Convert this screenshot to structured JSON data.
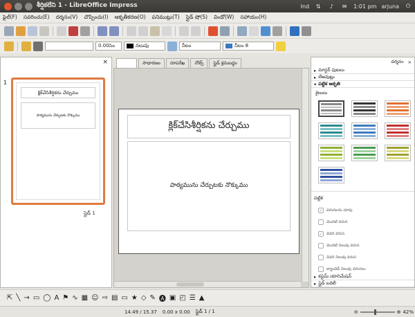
{
  "window": {
    "title": "శీర్షికలేని 1 - LibreOffice Impress",
    "tray": [
      "Ind",
      "1:01 pm",
      "arjuna"
    ]
  },
  "menu": [
    "ఫైల్(F)",
    "సవరించు(E)",
    "దర్శనం(V)",
    "చొప్పించు(I)",
    "ఆకృతీకరణ(O)",
    "పనిముట్లు(T)",
    "స్లైడ్ షో(S)",
    "విండో(W)",
    "సహాయం(H)"
  ],
  "toolbar": {
    "font_name": "",
    "font_size": "",
    "line_width": "0.00సెం",
    "line_color": "నలుపు",
    "area_color": "నీలం",
    "area_fill": "నీలం 8"
  },
  "slides_pane": {
    "slide_number": "1",
    "thumb_title": "క్లిక్‌చేసిశీర్షికను చేర్చుము",
    "thumb_body": "పాఠ్యమును చేర్చుటకు నొక్కుము",
    "footer": "స్లైడ్ 1"
  },
  "editor": {
    "tabs": [
      "",
      "సాధారణం",
      "రూపరేఖ",
      "నోట్స్",
      "స్లైడ్ క్రమబద్ధం"
    ],
    "slide_title": "క్లిక్‌చేసిశీర్షికను చేర్చుము",
    "slide_body": "పాఠ్యమును చేర్చుటకు నొక్కుము"
  },
  "task_pane": {
    "view_label": "దర్శనం",
    "sections": [
      "మాస్టర్ పుటలు",
      "లేఅవుట్లు",
      "పట్టిక ఆకృతి"
    ],
    "layouts_label": "శైలులు",
    "tables_label": "పట్టిక",
    "options": [
      "పరుసలను చూపు",
      "మొదటి వరుస",
      "చివరి వరుస",
      "మొదటి నిలువు వరుస",
      "చివరి నిలువు వరుస",
      "బ్యాండెడ్ నిలువు వరుసలు"
    ],
    "bottom_sections": [
      "కస్టమ్ యానిమేషన్",
      "స్లైడ్ బదిలీ"
    ]
  },
  "status": {
    "position": "14.49 / 15.37",
    "size": "0.00 x 0.00",
    "slide": "స్లైడ్ 1 / 1",
    "zoom": "42%"
  },
  "colors": {
    "accent": "#e07a40",
    "grid_blue": "#3a78c0",
    "grid_green": "#4a9a50",
    "grid_orange": "#e07030",
    "grid_gray": "#888888"
  }
}
